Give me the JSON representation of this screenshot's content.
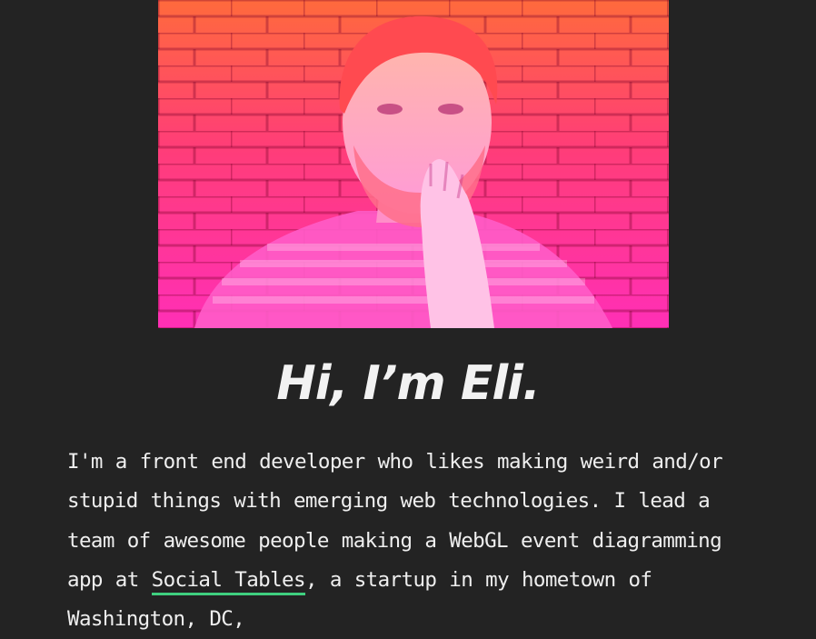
{
  "hero": {
    "image_alt": "Portrait of Eli in front of a brick wall with a pink-orange gradient tint"
  },
  "headline": "Hi, I’m Eli.",
  "bio": {
    "text_1": "I'm a front end developer who likes making weird and/or stupid things with emerging web technologies. I lead a team of awesome people making a WebGL event diagramming app at ",
    "link_label": "Social Tables",
    "text_2": ", a startup in my hometown of Washington, DC,"
  },
  "colors": {
    "background": "#232323",
    "link_underline": "#3fcf7f",
    "gradient_top": "#ff6a3c",
    "gradient_bottom": "#ff2fb6"
  }
}
